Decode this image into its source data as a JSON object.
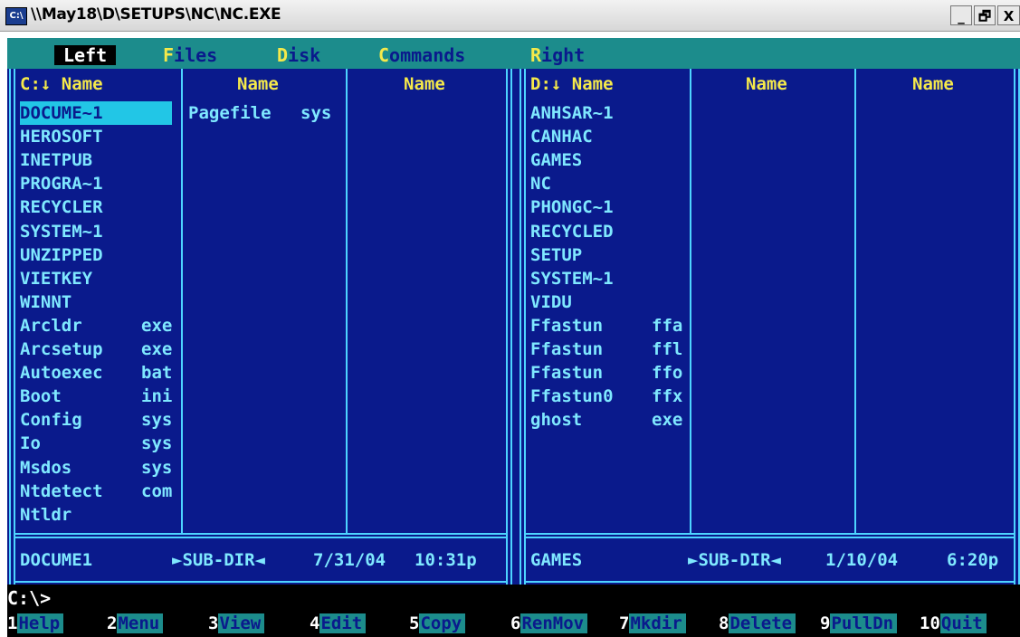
{
  "window": {
    "title": "\\\\May18\\D\\SETUPS\\NC\\NC.EXE",
    "icon": "C:\\",
    "buttons": [
      "_",
      "🗗",
      "X"
    ]
  },
  "menu": [
    {
      "hk": "",
      "rest": "Left"
    },
    {
      "hk": "F",
      "rest": "iles"
    },
    {
      "hk": "D",
      "rest": "isk"
    },
    {
      "hk": "C",
      "rest": "ommands"
    },
    {
      "hk": "R",
      "rest": "ight"
    }
  ],
  "left_panel": {
    "col_headers": [
      "C:↓ Name",
      "Name",
      "Name"
    ],
    "col1": [
      {
        "name": "DOCUME~1",
        "ext": ""
      },
      {
        "name": "HEROSOFT",
        "ext": ""
      },
      {
        "name": "INETPUB",
        "ext": ""
      },
      {
        "name": "PROGRA~1",
        "ext": ""
      },
      {
        "name": "RECYCLER",
        "ext": ""
      },
      {
        "name": "SYSTEM~1",
        "ext": ""
      },
      {
        "name": "UNZIPPED",
        "ext": ""
      },
      {
        "name": "VIETKEY",
        "ext": ""
      },
      {
        "name": "WINNT",
        "ext": ""
      },
      {
        "name": "Arcldr",
        "ext": "exe"
      },
      {
        "name": "Arcsetup",
        "ext": "exe"
      },
      {
        "name": "Autoexec",
        "ext": "bat"
      },
      {
        "name": "Boot",
        "ext": "ini"
      },
      {
        "name": "Config",
        "ext": "sys"
      },
      {
        "name": "Io",
        "ext": "sys"
      },
      {
        "name": "Msdos",
        "ext": "sys"
      },
      {
        "name": "Ntdetect",
        "ext": "com"
      },
      {
        "name": "Ntldr",
        "ext": ""
      }
    ],
    "col2": [
      {
        "name": "Pagefile",
        "ext": "sys"
      }
    ],
    "status": {
      "name": "DOCUME1",
      "type": "►SUB-DIR◄",
      "date": "7/31/04",
      "time": "10:31p"
    }
  },
  "right_panel": {
    "col_headers": [
      "D:↓ Name",
      "Name",
      "Name"
    ],
    "col1": [
      {
        "name": "ANHSAR~1",
        "ext": ""
      },
      {
        "name": "CANHAC",
        "ext": ""
      },
      {
        "name": "GAMES",
        "ext": ""
      },
      {
        "name": "NC",
        "ext": ""
      },
      {
        "name": "PHONGC~1",
        "ext": ""
      },
      {
        "name": "RECYCLED",
        "ext": ""
      },
      {
        "name": "SETUP",
        "ext": ""
      },
      {
        "name": "SYSTEM~1",
        "ext": ""
      },
      {
        "name": "VIDU",
        "ext": ""
      },
      {
        "name": "Ffastun",
        "ext": "ffa"
      },
      {
        "name": "Ffastun",
        "ext": "ffl"
      },
      {
        "name": "Ffastun",
        "ext": "ffo"
      },
      {
        "name": "Ffastun0",
        "ext": "ffx"
      },
      {
        "name": "ghost",
        "ext": "exe"
      }
    ],
    "status": {
      "name": "GAMES",
      "type": "►SUB-DIR◄",
      "date": "1/10/04",
      "time": "6:20p"
    }
  },
  "prompt": "C:\\>",
  "fkeys": [
    {
      "num": "1",
      "label": "Help"
    },
    {
      "num": "2",
      "label": "Menu"
    },
    {
      "num": "3",
      "label": "View"
    },
    {
      "num": "4",
      "label": "Edit"
    },
    {
      "num": "5",
      "label": "Copy"
    },
    {
      "num": "6",
      "label": "RenMov"
    },
    {
      "num": "7",
      "label": "Mkdir"
    },
    {
      "num": "8",
      "label": "Delete"
    },
    {
      "num": "9",
      "label": "PullDn"
    },
    {
      "num": "10",
      "label": "Quit"
    }
  ],
  "colors": {
    "background": "#0a1a8c",
    "menubar": "#1c8c8c",
    "text": "#7fe8ff",
    "header": "#f5e94a",
    "selection": "#22c6e6"
  }
}
